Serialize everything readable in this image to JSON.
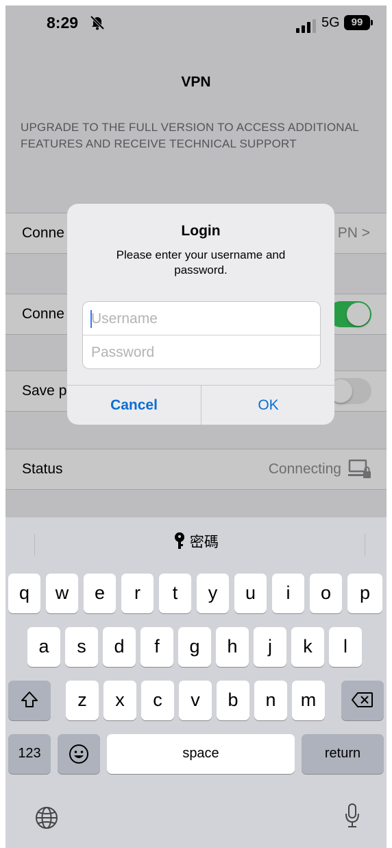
{
  "status_bar": {
    "time": "8:29",
    "network": "5G",
    "battery": "99"
  },
  "nav": {
    "title": "VPN"
  },
  "section_note": "UPGRADE TO THE FULL VERSION TO ACCESS ADDITIONAL FEATURES AND RECEIVE TECHNICAL SUPPORT",
  "rows": {
    "row1_label": "Conne",
    "row1_value": "PN >",
    "row2_label": "Conne",
    "row3_label": "Save p",
    "status_label": "Status",
    "status_value": "Connecting"
  },
  "dialog": {
    "title": "Login",
    "message": "Please enter your username and password.",
    "username_placeholder": "Username",
    "password_placeholder": "Password",
    "cancel": "Cancel",
    "ok": "OK"
  },
  "keyboard": {
    "suggestion": "密碼",
    "row1": [
      "q",
      "w",
      "e",
      "r",
      "t",
      "y",
      "u",
      "i",
      "o",
      "p"
    ],
    "row2": [
      "a",
      "s",
      "d",
      "f",
      "g",
      "h",
      "j",
      "k",
      "l"
    ],
    "row3": [
      "z",
      "x",
      "c",
      "v",
      "b",
      "n",
      "m"
    ],
    "numbers_key": "123",
    "space_key": "space",
    "return_key": "return"
  }
}
